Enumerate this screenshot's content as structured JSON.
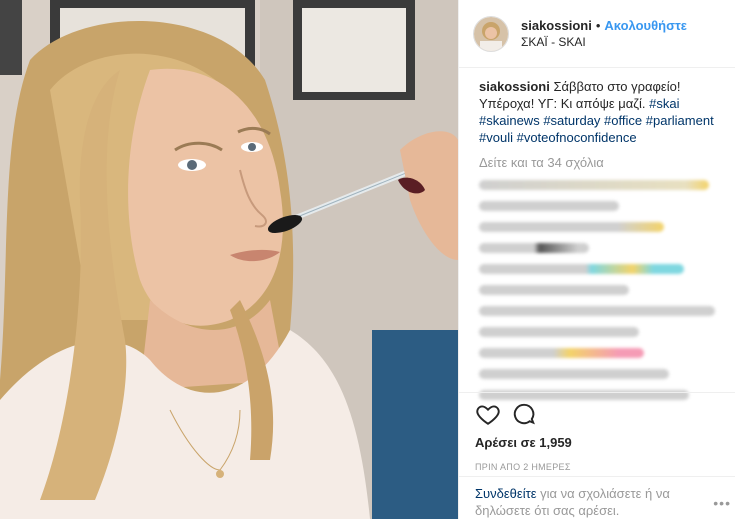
{
  "header": {
    "username": "siakossioni",
    "separator": "•",
    "follow_label": "Ακολουθήστε",
    "location": "ΣΚΑΪ - SKAI"
  },
  "caption": {
    "username": "siakossioni",
    "text": "Σάββατο στο γραφείο! Υπέροχα! ΥΓ: Κι απόψε μαζί.",
    "hashtags": [
      "#skai",
      "#skainews",
      "#saturday",
      "#office",
      "#parliament",
      "#vouli",
      "#voteofnoconfidence"
    ]
  },
  "comments": {
    "view_more": "Δείτε και τα 34 σχόλια"
  },
  "actions": {
    "likes": "Αρέσει σε 1,959",
    "timestamp": "ΠΡΙΝ ΑΠΟ 2 ΗΜΕΡΕΣ"
  },
  "login": {
    "link": "Συνδεθείτε",
    "text": "για να σχολιάσετε ή να δηλώσετε ότι σας αρέσει."
  },
  "more_menu": "•••",
  "icons": {
    "like": "heart-icon",
    "comment": "comment-icon"
  },
  "colors": {
    "link_blue": "#3897f0",
    "hashtag": "#003569",
    "muted": "#999999"
  }
}
